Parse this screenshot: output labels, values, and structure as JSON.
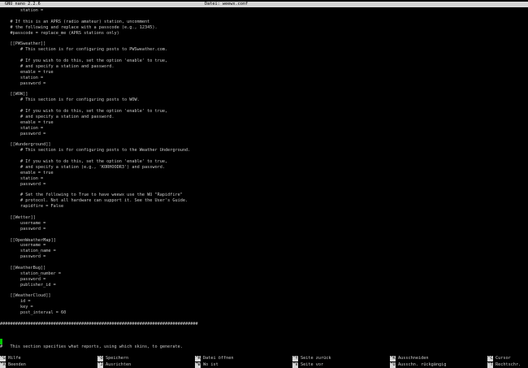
{
  "titlebar": {
    "app": "GNU nano 2.2.6",
    "file": "Datei: weewx.conf"
  },
  "lines": [
    "        station =",
    "",
    "    # If this is an APRS (radio amateur) station, uncomment",
    "    # the following and replace with a passcode (e.g., 12345).",
    "    #passcode = replace_me (APRS stations only)",
    "",
    "    [[PWSweather]]",
    "        # This section is for configuring posts to PWSweather.com.",
    "",
    "        # If you wish to do this, set the option 'enable' to true,",
    "        # and specify a station and password.",
    "        enable = true",
    "        station =",
    "        password =",
    "",
    "    [[WOW]]",
    "        # This section is for configuring posts to WOW.",
    "",
    "        # If you wish to do this, set the option 'enable' to true,",
    "        # and specify a station and password.",
    "        enable = true",
    "        station =",
    "        password =",
    "",
    "    [[Wunderground]]",
    "        # This section is for configuring posts to the Weather Underground.",
    "",
    "        # If you wish to do this, set the option 'enable' to true,",
    "        # and specify a station (e.g., 'KORHOODR3') and password.",
    "        enable = true",
    "        station =",
    "        password =",
    "",
    "        # Set the following to True to have weewx use the WU \"Rapidfire\"",
    "        # protocol. Not all hardware can support it. See the User's Guide.",
    "        rapidfire = False",
    "",
    "    [[Wetter]]",
    "        username =",
    "        password =",
    "",
    "    [[OpenWeatherMap]]",
    "        username =",
    "        station_name =",
    "        password =",
    "",
    "    [[WeatherBug]]",
    "        station_number =",
    "        password =",
    "        publisher_id =",
    "",
    "    [[WeatherCloud]]",
    "        id =",
    "        key =",
    "        post_interval = 60",
    "",
    "##############################################################################"
  ],
  "after_cursor": "#   This section specifies what reports, using which skins, to generate.",
  "shortcuts": {
    "row1": [
      {
        "key": "^G",
        "label": "Hilfe"
      },
      {
        "key": "^O",
        "label": "Speichern"
      },
      {
        "key": "^R",
        "label": "Datei öffnen"
      },
      {
        "key": "^Y",
        "label": "Seite zurück"
      },
      {
        "key": "^K",
        "label": "Ausschneiden"
      },
      {
        "key": "^C",
        "label": "Cursor"
      }
    ],
    "row2": [
      {
        "key": "^X",
        "label": "Beenden"
      },
      {
        "key": "^J",
        "label": "Ausrichten"
      },
      {
        "key": "^W",
        "label": "Wo ist"
      },
      {
        "key": "^V",
        "label": "Seite vor"
      },
      {
        "key": "^U",
        "label": "Ausschn. rückgängig"
      },
      {
        "key": "^T",
        "label": "Rechtschr."
      }
    ]
  }
}
